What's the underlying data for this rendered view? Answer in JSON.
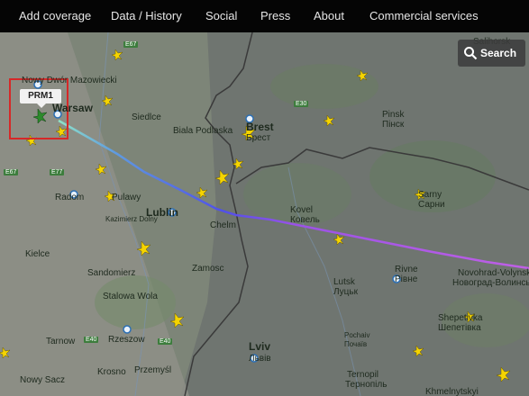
{
  "nav": {
    "items": [
      "Add coverage",
      "Data / History",
      "Social",
      "Press",
      "About",
      "Commercial services"
    ]
  },
  "map": {
    "search_label": "Search",
    "selected_flight": "PRM1",
    "colors": {
      "route_start": "#7fe0c0",
      "route_mid": "#4a5ae0",
      "route_end": "#b24fe0",
      "highlight": "#d62828",
      "plane": "#f5d400"
    },
    "cities": [
      "Nowy Dwór Mazowiecki",
      "Warsaw",
      "Siedlce",
      "Biala Podlaska",
      "Brest",
      "Брест",
      "Pinsk",
      "Пінск",
      "Salihorsk",
      "Radom",
      "Pulawy",
      "Kazimierz Dolny",
      "Lublin",
      "Chelm",
      "Kovel",
      "Ковель",
      "Sarny",
      "Сарни",
      "Kielce",
      "Sandomierz",
      "Zamosc",
      "Lutsk",
      "Луцьк",
      "Rivne",
      "Рівне",
      "Stalowa Wola",
      "Novohrad-Volynskyi",
      "Новоград-Волинсь",
      "Rzeszow",
      "Tarnow",
      "Shepetivka",
      "Шепетівка",
      "Lviv",
      "Львів",
      "Pochaiv",
      "Почаїв",
      "Krosno",
      "Przemyśl",
      "Nowy Sacz",
      "Ternopil",
      "Тернопіль",
      "Khmelnytskyi"
    ],
    "roads": [
      "E67",
      "E30",
      "E67",
      "E77",
      "E40",
      "E40"
    ]
  }
}
